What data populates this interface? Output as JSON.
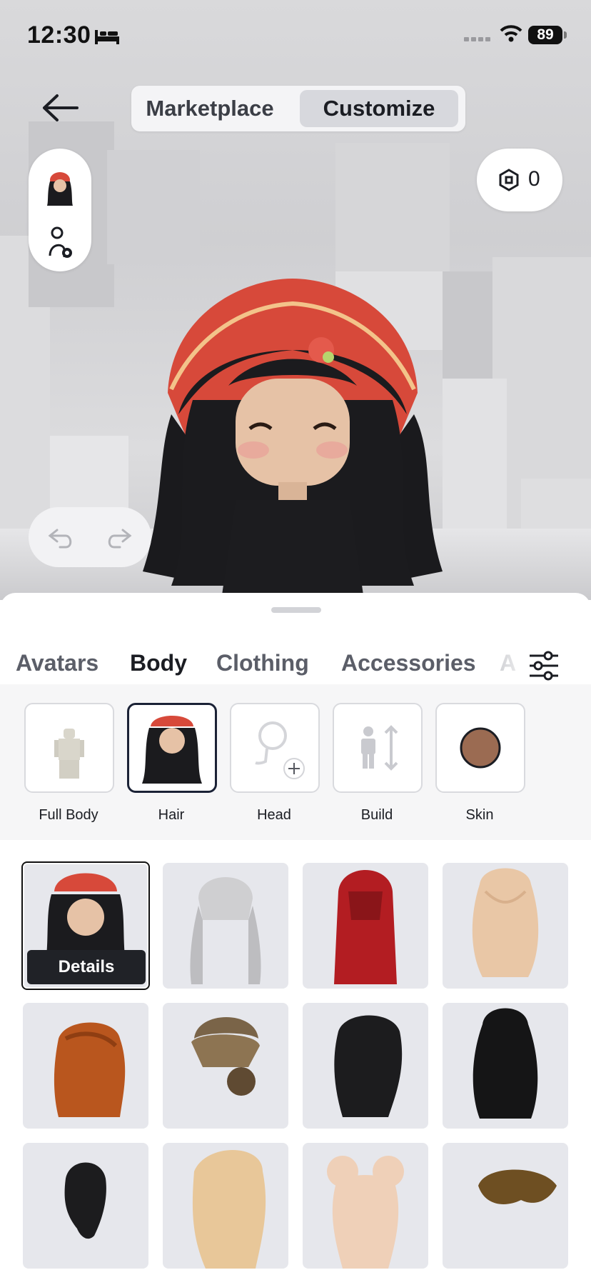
{
  "status_bar": {
    "time": "12:30",
    "battery": "89",
    "icons": [
      "bed-icon",
      "cell-signal-icon",
      "wifi-icon",
      "battery-icon"
    ]
  },
  "header": {
    "segments": [
      {
        "label": "Marketplace",
        "selected": false
      },
      {
        "label": "Customize",
        "selected": true
      }
    ],
    "robux": {
      "icon": "robux-icon",
      "count": "0"
    }
  },
  "tabs": [
    {
      "label": "Avatars",
      "active": false
    },
    {
      "label": "Body",
      "active": true
    },
    {
      "label": "Clothing",
      "active": false
    },
    {
      "label": "Accessories",
      "active": false
    },
    {
      "label": "A",
      "active": false
    }
  ],
  "subcategories": [
    {
      "label": "Full Body",
      "icon": "full-body-icon",
      "selected": false
    },
    {
      "label": "Hair",
      "icon": "hair-thumb",
      "selected": true
    },
    {
      "label": "Head",
      "icon": "head-add-icon",
      "selected": false
    },
    {
      "label": "Build",
      "icon": "build-icon",
      "selected": false
    },
    {
      "label": "Skin",
      "icon": "skin-swatch",
      "selected": false
    }
  ],
  "items": {
    "details_label": "Details",
    "list": [
      {
        "name": "equipped-hair-with-beanie",
        "color": "#1b1b1e",
        "selected": true
      },
      {
        "name": "silver-pigtails",
        "color": "#cfcfd1"
      },
      {
        "name": "red-long-hair",
        "color": "#b31d22"
      },
      {
        "name": "blonde-wavy",
        "color": "#e9c7a6"
      },
      {
        "name": "orange-layered",
        "color": "#b9561e"
      },
      {
        "name": "brown-bun",
        "color": "#7a6448"
      },
      {
        "name": "black-messy-long",
        "color": "#1c1c1e"
      },
      {
        "name": "black-straight-long",
        "color": "#151516"
      },
      {
        "name": "black-ponytail",
        "color": "#1c1c1e"
      },
      {
        "name": "blonde-side-wave",
        "color": "#e8c799"
      },
      {
        "name": "pink-space-buns",
        "color": "#efd0b8"
      },
      {
        "name": "brown-swept",
        "color": "#6e4f22"
      }
    ]
  },
  "colors": {
    "skin": "#9b6b52",
    "accent": "#1b2236",
    "sheet_bg": "#f6f6f7"
  }
}
